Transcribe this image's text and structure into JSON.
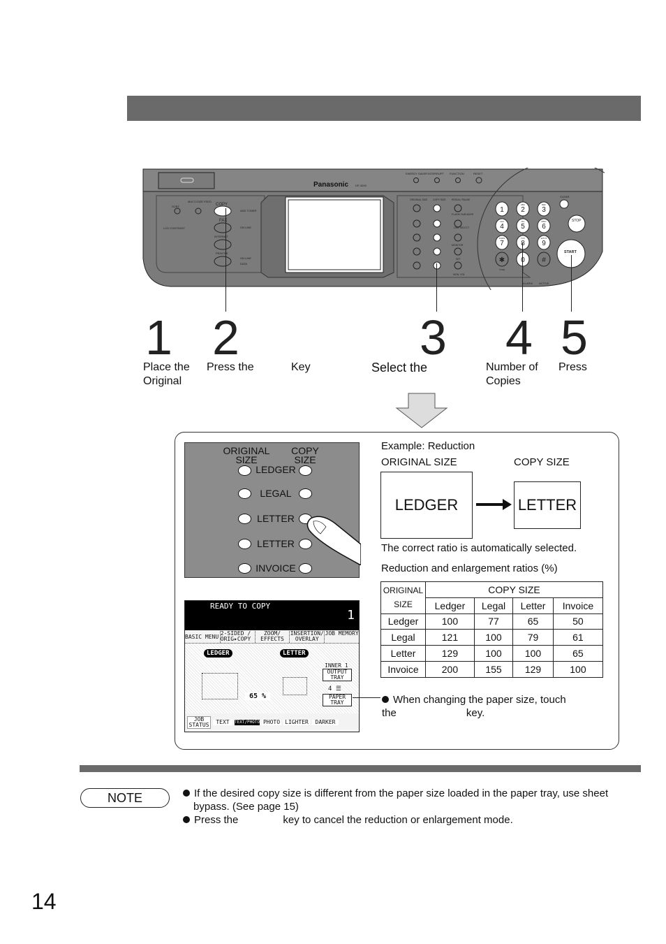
{
  "panel": {
    "brand": "Panasonic",
    "model": "DP-3000",
    "top_keys": [
      "ENERGY SAVER",
      "INTERRUPT",
      "FUNCTION",
      "RESET"
    ],
    "left_labels": {
      "sort": "SORT",
      "multi_size_feed": "MULTI-SIZE FEED",
      "copy": "COPY",
      "fax": "FAX",
      "internet": "INTERNET",
      "printer": "PRINTER",
      "lcd_contrast": "LCD CONTRAST",
      "add_toner": "ADD TONER",
      "on_line": "ON LINE",
      "on_line2": "ON LINE",
      "data": "DATA"
    },
    "middle_labels": {
      "original_size": "ORIGINAL SIZE",
      "copy_size": "COPY SIZE",
      "redial_pause": "REDIAL/ PAUSE",
      "flash_sub_addr": "FLASH/ SUB ADDR",
      "line_select": "LINE SELECT",
      "monitor": "MONITOR",
      "set": "SET",
      "mon_vol": "MON. VOL"
    },
    "keypad": [
      {
        "n": "1",
        "s": ""
      },
      {
        "n": "2",
        "s": "ABC"
      },
      {
        "n": "3",
        "s": "DEF"
      },
      {
        "n": "4",
        "s": "GHI"
      },
      {
        "n": "5",
        "s": "JKL"
      },
      {
        "n": "6",
        "s": "MNO"
      },
      {
        "n": "7",
        "s": "PQRS"
      },
      {
        "n": "8",
        "s": "TUV"
      },
      {
        "n": "9",
        "s": "WXYZ"
      },
      {
        "n": "✱",
        "s": "TONE"
      },
      {
        "n": "0",
        "s": ""
      },
      {
        "n": "#",
        "s": ""
      }
    ],
    "clear": "CLEAR",
    "stop": "STOP",
    "start": "START",
    "alarm": "ALARM",
    "active": "ACTIVE"
  },
  "steps": [
    {
      "num": "1",
      "text": "Place the Original"
    },
    {
      "num": "2",
      "text": "Press the",
      "extra": "Key"
    },
    {
      "num": "3",
      "text": "Select the"
    },
    {
      "num": "4",
      "text": "Number of Copies"
    },
    {
      "num": "5",
      "text": "Press"
    }
  ],
  "key_panel": {
    "original_size": "ORIGINAL SIZE",
    "copy_size": "COPY SIZE",
    "rows": [
      "LEDGER",
      "LEGAL",
      "LETTER",
      "LETTER",
      "INVOICE"
    ]
  },
  "lcd": {
    "status": "READY TO COPY",
    "count": "1",
    "tabs": [
      "BASIC MENU",
      "2-SIDED / ORIG▸COPY",
      "ZOOM/ EFFECTS",
      "INSERTION/ OVERLAY",
      "JOB MEMORY"
    ],
    "original": "LEDGER",
    "copy": "LETTER",
    "output_tray_top": "INNER 1",
    "output_tray": "OUTPUT TRAY",
    "tray_num": "4 ☰",
    "paper_tray": "PAPER TRAY",
    "ratio": "65 %",
    "bottom": [
      "JOB STATUS",
      "TEXT",
      "TEXT/PHOTO",
      "PHOTO",
      "LIGHTER",
      "DARKER"
    ]
  },
  "example": {
    "title": "Example: Reduction",
    "original_label": "ORIGINAL SIZE",
    "copy_label": "COPY SIZE",
    "original": "LEDGER",
    "copy": "LETTER",
    "auto_text": "The correct ratio is automatically selected.",
    "ratios_title": "Reduction and enlargement ratios (%)"
  },
  "ratio_table": {
    "corner": "ORIGINAL SIZE",
    "group": "COPY SIZE",
    "columns": [
      "Ledger",
      "Legal",
      "Letter",
      "Invoice"
    ],
    "rows": [
      {
        "name": "Ledger",
        "values": [
          "100",
          "77",
          "65",
          "50"
        ]
      },
      {
        "name": "Legal",
        "values": [
          "121",
          "100",
          "79",
          "61"
        ]
      },
      {
        "name": "Letter",
        "values": [
          "129",
          "100",
          "100",
          "65"
        ]
      },
      {
        "name": "Invoice",
        "values": [
          "200",
          "155",
          "129",
          "100"
        ]
      }
    ]
  },
  "paper_note": "When changing the paper size, touch the",
  "paper_note_end": "key.",
  "note": {
    "label": "NOTE",
    "items": [
      "If the desired copy size is different from the paper size loaded in the paper tray, use sheet bypass. (See page 15)",
      "Press the",
      "key to cancel the reduction or enlargement mode."
    ]
  },
  "page_number": "14"
}
